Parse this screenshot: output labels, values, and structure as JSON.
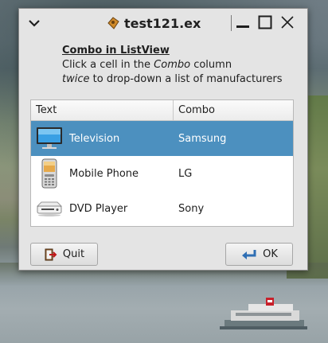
{
  "window": {
    "title": "test121.ex",
    "icon": "app-icon"
  },
  "description": {
    "heading": "Combo in ListView",
    "line1_prefix": "Click a cell in the ",
    "line1_emph": "Combo",
    "line1_suffix": " column",
    "line2_emph": "twice",
    "line2_suffix": " to drop-down a list of manufacturers"
  },
  "listview": {
    "columns": [
      "Text",
      "Combo"
    ],
    "rows": [
      {
        "text": "Television",
        "combo": "Samsung",
        "icon": "television-icon",
        "selected": true
      },
      {
        "text": "Mobile Phone",
        "combo": "LG",
        "icon": "mobile-phone-icon",
        "selected": false
      },
      {
        "text": "DVD Player",
        "combo": "Sony",
        "icon": "dvd-player-icon",
        "selected": false
      }
    ]
  },
  "buttons": {
    "quit": "Quit",
    "ok": "OK"
  },
  "colors": {
    "selection": "#4c90bf",
    "window_bg": "#e4e4e4"
  }
}
